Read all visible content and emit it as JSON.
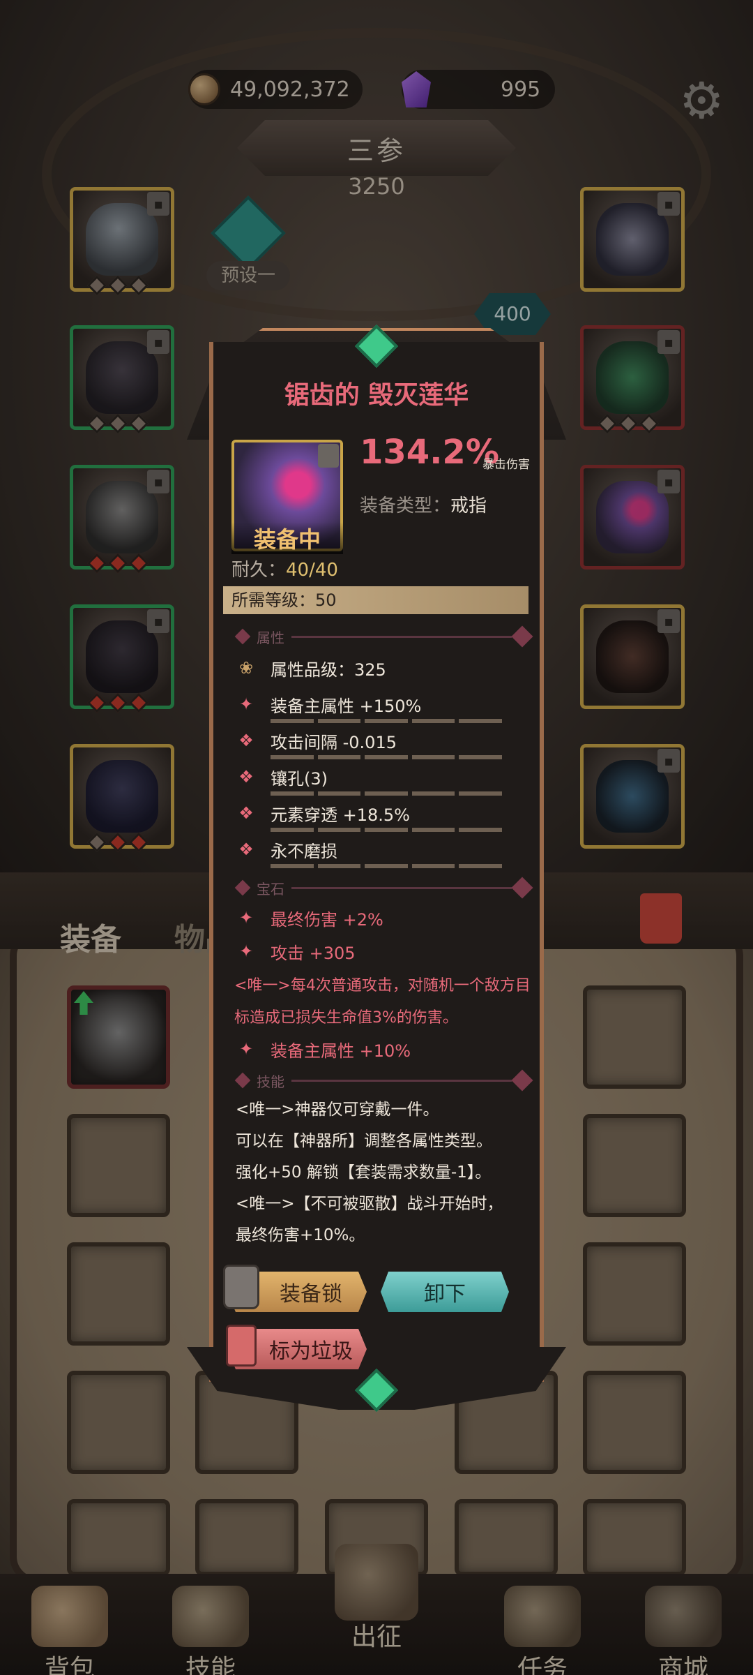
{
  "resources": {
    "gold": "49,092,372",
    "gems": "995"
  },
  "hero": {
    "name": "三参",
    "power": "3250",
    "preset_label": "预设一",
    "badge": "400"
  },
  "tabs": {
    "equipment": "装备",
    "items": "物品"
  },
  "item": {
    "name": "锯齿的 毁灭莲华",
    "main_stat_value": "134.2%",
    "main_stat_name": "暴击伤害",
    "type_label": "装备类型：",
    "type_value": "戒指",
    "equipped_label": "装备中",
    "durability_label": "耐久：",
    "durability_value": "40/40",
    "level_req": "所需等级：50",
    "sections": {
      "attributes": "属性",
      "gems": "宝石",
      "skills": "技能"
    },
    "attributes": [
      "属性品级：325",
      "装备主属性 +150%",
      "攻击间隔 -0.015",
      "镶孔(3)",
      "元素穿透 +18.5%",
      "永不磨损"
    ],
    "gem_attributes": [
      "最终伤害 +2%",
      "攻击 +305"
    ],
    "unique_effect": "<唯一>每4次普通攻击，对随机一个敌方目标造成已损失生命值3%的伤害。",
    "gem_attribute_extra": "装备主属性 +10%",
    "skill_lines": [
      "<唯一>神器仅可穿戴一件。",
      "可以在【神器所】调整各属性类型。",
      "强化+50 解锁【套装需求数量-1】。",
      "<唯一>【不可被驱散】战斗开始时，",
      "最终伤害+10%。"
    ],
    "buttons": {
      "lock": "装备锁",
      "unequip": "卸下",
      "mark_junk": "标为垃圾"
    }
  },
  "nav": {
    "backpack": "背包",
    "skills": "技能",
    "expedition": "出征",
    "quests": "任务",
    "shop": "商城"
  },
  "colors": {
    "accent_red": "#e86a7a",
    "gold_border": "#c9a548",
    "green_border": "#2f9a56",
    "teal_button": "#3d9c98"
  }
}
